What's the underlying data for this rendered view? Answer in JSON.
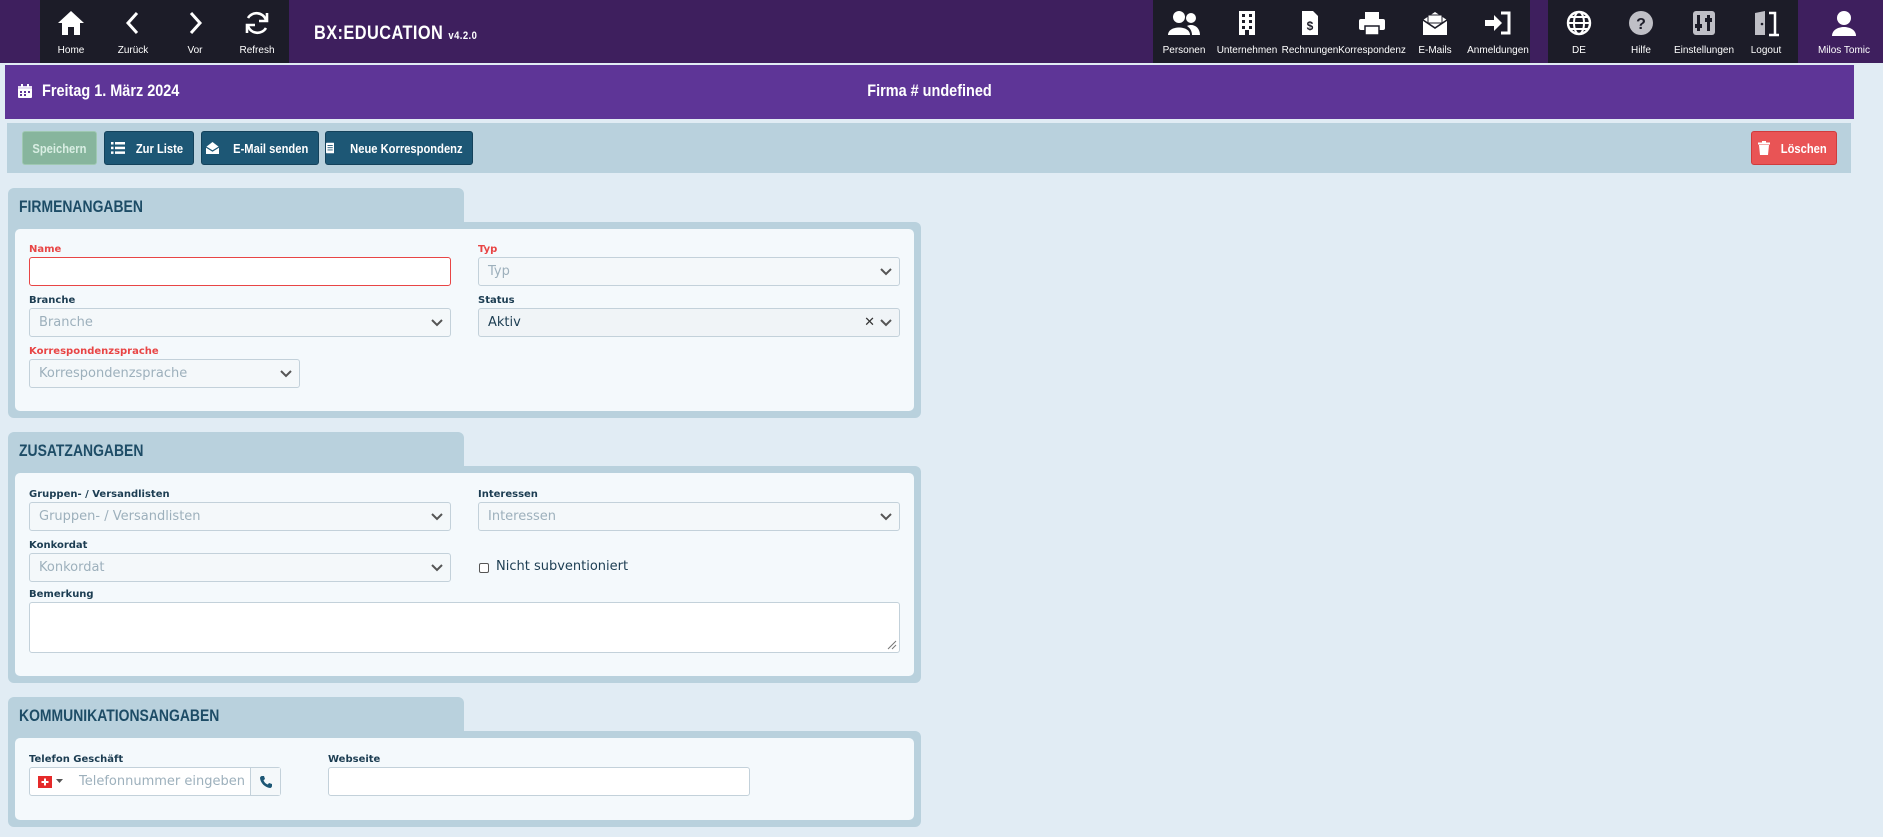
{
  "app": {
    "brand": "BX:EDUCATION",
    "version": "v4.2.0"
  },
  "nav_left": [
    {
      "label": "Home",
      "icon": "home-icon"
    },
    {
      "label": "Zurück",
      "icon": "chevron-left-icon"
    },
    {
      "label": "Vor",
      "icon": "chevron-right-icon"
    },
    {
      "label": "Refresh",
      "icon": "refresh-icon"
    }
  ],
  "nav_right": [
    {
      "label": "Personen",
      "icon": "persons-icon"
    },
    {
      "label": "Unternehmen",
      "icon": "building-icon"
    },
    {
      "label": "Rechnungen",
      "icon": "invoice-icon"
    },
    {
      "label": "Korrespondenz",
      "icon": "printer-icon"
    },
    {
      "label": "E-Mails",
      "icon": "mail-icon"
    },
    {
      "label": "Anmeldungen",
      "icon": "sign-in-icon"
    },
    {
      "label": "DE",
      "icon": "globe-icon"
    },
    {
      "label": "Hilfe",
      "icon": "help-icon"
    },
    {
      "label": "Einstellungen",
      "icon": "settings-icon"
    },
    {
      "label": "Logout",
      "icon": "logout-door-icon"
    },
    {
      "label": "Milos Tomic",
      "icon": "user-icon"
    }
  ],
  "header": {
    "date": "Freitag 1. März 2024",
    "title": "Firma # undefined"
  },
  "toolbar": {
    "save": "Speichern",
    "list": "Zur Liste",
    "email": "E-Mail senden",
    "correspondence": "Neue Korrespondenz",
    "delete": "Löschen"
  },
  "firmenangaben": {
    "heading": "FIRMENANGABEN",
    "name_label": "Name",
    "name_value": "",
    "typ_label": "Typ",
    "typ_placeholder": "Typ",
    "branche_label": "Branche",
    "branche_placeholder": "Branche",
    "status_label": "Status",
    "status_value": "Aktiv",
    "sprache_label": "Korrespondenzsprache",
    "sprache_placeholder": "Korrespondenzsprache"
  },
  "zusatzangaben": {
    "heading": "ZUSATZANGABEN",
    "gruppen_label": "Gruppen- / Versandlisten",
    "gruppen_placeholder": "Gruppen- / Versandlisten",
    "interessen_label": "Interessen",
    "interessen_placeholder": "Interessen",
    "konkordat_label": "Konkordat",
    "konkordat_placeholder": "Konkordat",
    "subv_label": "Nicht subventioniert",
    "subv_checked": false,
    "bemerkung_label": "Bemerkung"
  },
  "kommunikation": {
    "heading": "KOMMUNIKATIONSANGABEN",
    "telefon_label": "Telefon Geschäft",
    "telefon_placeholder": "Telefonnummer eingeben",
    "webseite_label": "Webseite"
  },
  "colors": {
    "nav_bg": "#3e1f5e",
    "nav_group_bg": "#1c1c28",
    "header_bg": "#5e3597",
    "save_btn": "#87b59d",
    "primary_btn": "#1d5775",
    "delete_btn": "#e95455",
    "required": "#e84545",
    "section_bg": "#b9d1dd",
    "page_bg": "#e1ecf4"
  }
}
